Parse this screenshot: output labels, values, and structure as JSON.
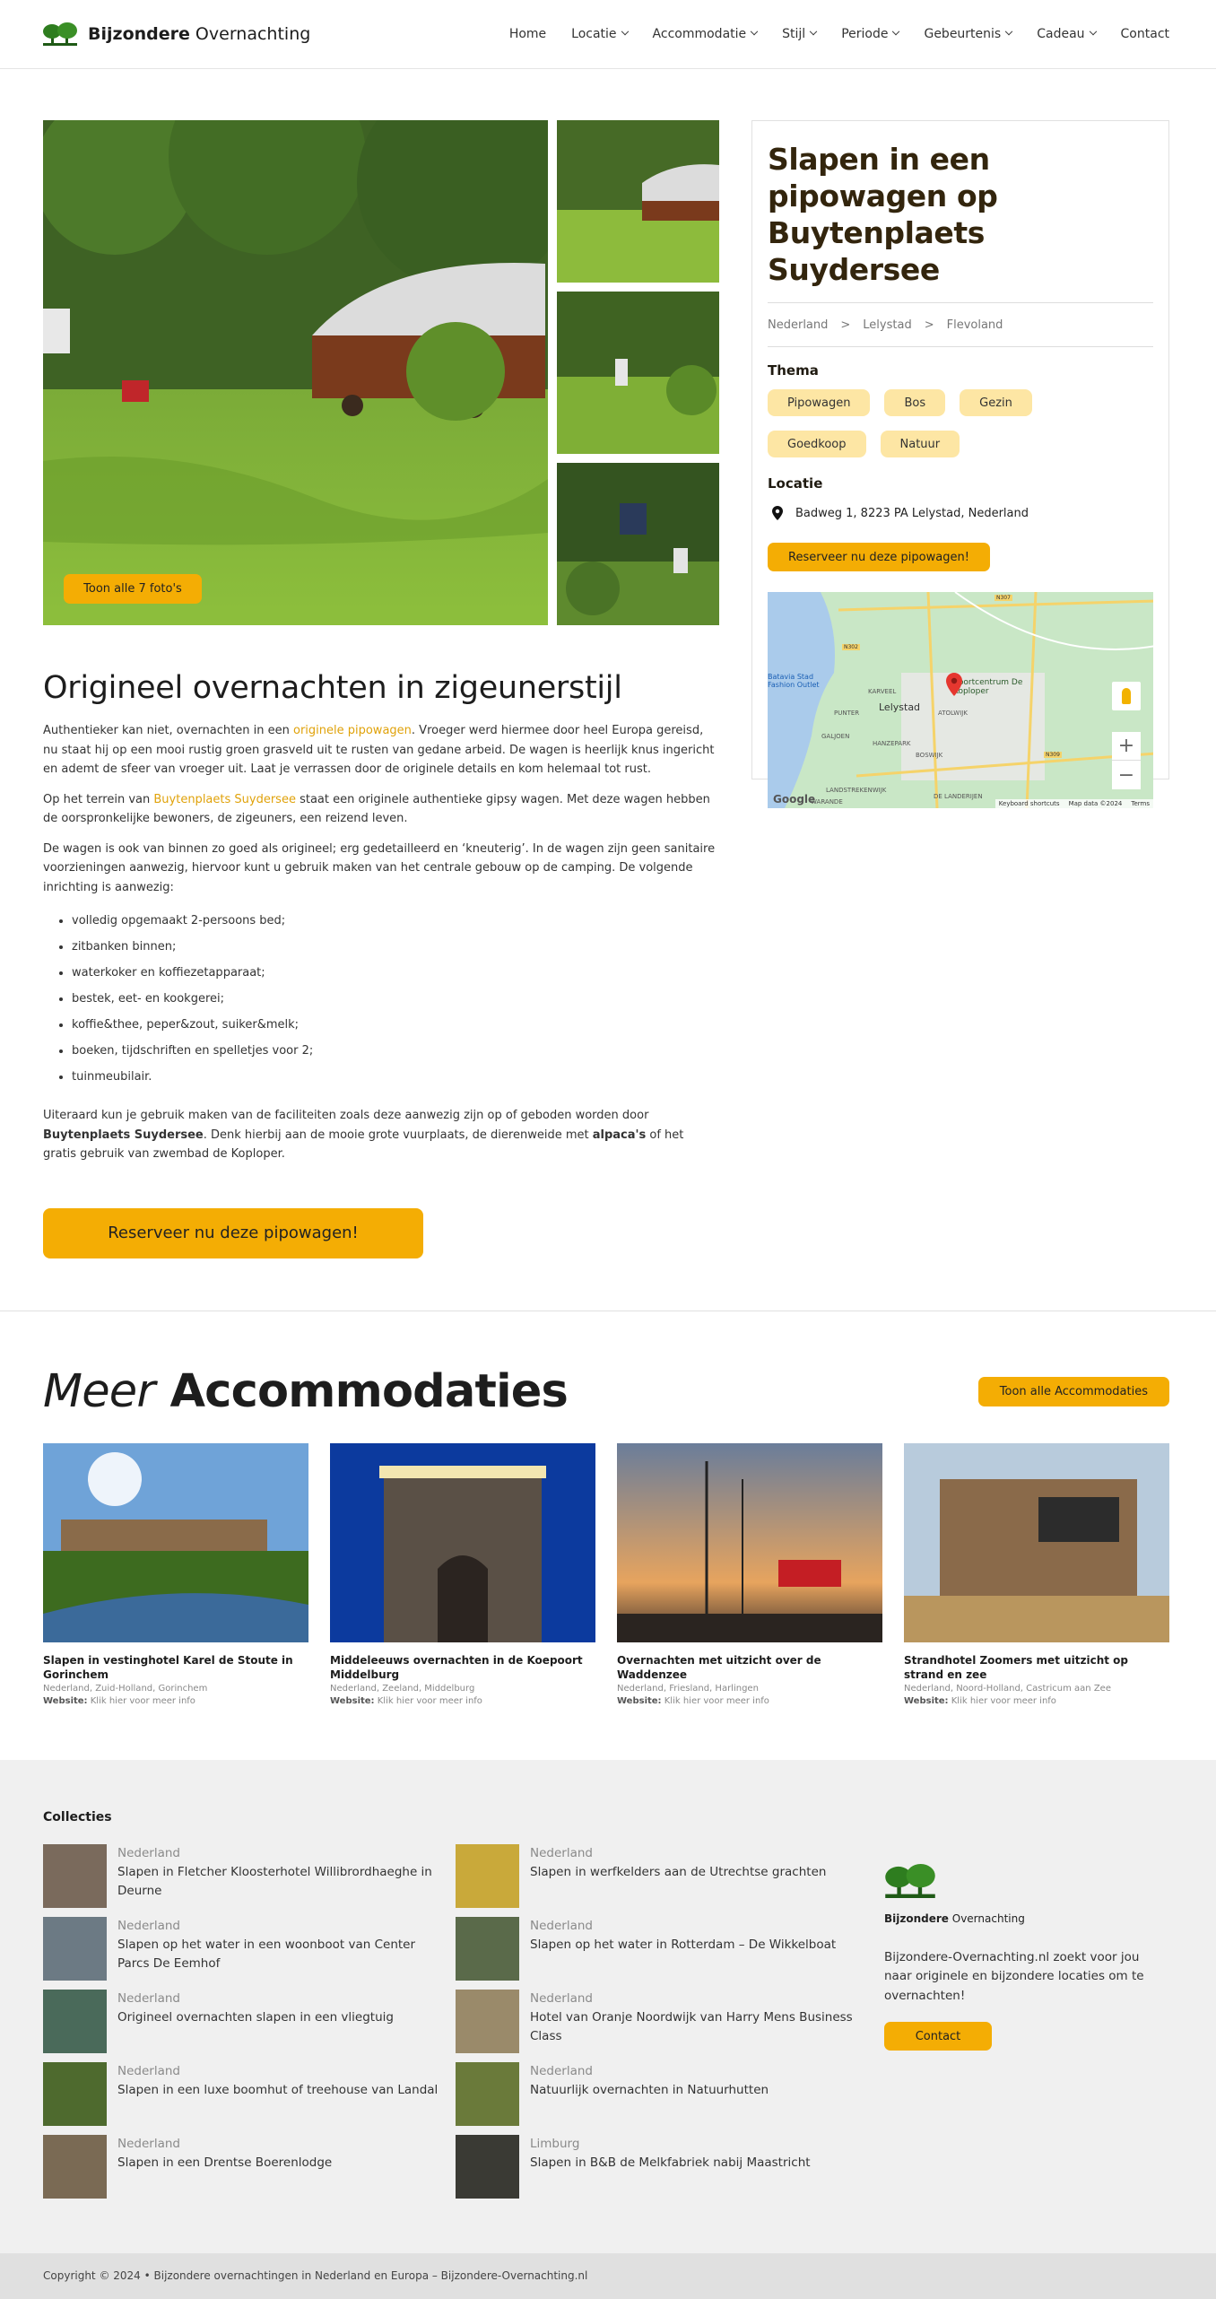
{
  "brand": {
    "bold": "Bijzondere",
    "rest": " Overnachting"
  },
  "nav": [
    {
      "label": "Home",
      "dropdown": false
    },
    {
      "label": "Locatie",
      "dropdown": true
    },
    {
      "label": "Accommodatie",
      "dropdown": true
    },
    {
      "label": "Stijl",
      "dropdown": true
    },
    {
      "label": "Periode",
      "dropdown": true
    },
    {
      "label": "Gebeurtenis",
      "dropdown": true
    },
    {
      "label": "Cadeau",
      "dropdown": true
    },
    {
      "label": "Contact",
      "dropdown": false
    }
  ],
  "gallery": {
    "show_all": "Toon alle 7 foto's"
  },
  "side": {
    "title": "Slapen in een pipowagen op Buytenplaets Suydersee",
    "breadcrumb": [
      "Nederland",
      ">",
      "Lelystad",
      ">",
      "Flevoland"
    ],
    "theme_label": "Thema",
    "tags": [
      "Pipowagen",
      "Bos",
      "Gezin",
      "Goedkoop",
      "Natuur"
    ],
    "location_label": "Locatie",
    "address": "Badweg 1, 8223 PA Lelystad, Nederland",
    "reserve": "Reserveer nu deze pipowagen!",
    "map": {
      "labels": [
        "Lelystad",
        "Sportcentrum De Koploper",
        "KARVEEL",
        "PUNTER",
        "ATOLWIJK",
        "GALJOEN",
        "HANZEPARK",
        "BOSWIJK",
        "LANDSTREKENWIJK",
        "DE LANDERIJEN",
        "WARANDE",
        "Batavia Stad Fashion Outlet",
        "N307",
        "N302",
        "N309"
      ],
      "footer": [
        "Keyboard shortcuts",
        "Map data ©2024",
        "Terms"
      ],
      "google": "Google"
    }
  },
  "article": {
    "title": "Origineel overnachten in zigeunerstijl",
    "p1_a": "Authentieker kan niet, overnachten in een ",
    "p1_link": "originele pipowagen",
    "p1_b": ". Vroeger werd hiermee door heel Europa gereisd, nu staat hij op een mooi rustig groen grasveld uit te rusten van gedane arbeid. De wagen is heerlijk knus ingericht en ademt de sfeer van vroeger uit. Laat je verrassen door de originele details en kom helemaal tot rust.",
    "p2_a": "Op het terrein van ",
    "p2_link": "Buytenplaets Suydersee",
    "p2_b": " staat een originele authentieke gipsy wagen. Met deze wagen hebben de oorspronkelijke bewoners, de zigeuners, een reizend leven.",
    "p3": "De wagen is ook van binnen zo goed als origineel; erg gedetailleerd en ‘kneuterig’. In de wagen zijn geen sanitaire voorzieningen aanwezig, hiervoor kunt u gebruik maken van het centrale gebouw op de camping. De volgende inrichting is aanwezig:",
    "list": [
      "volledig opgemaakt 2-persoons bed;",
      "zitbanken binnen;",
      "waterkoker en koffiezetapparaat;",
      "bestek, eet- en kookgerei;",
      "koffie&thee, peper&zout, suiker&melk;",
      "boeken, tijdschriften en spelletjes voor 2;",
      "tuinmeubilair."
    ],
    "p4_a": "Uiteraard kun je gebruik maken van de faciliteiten zoals deze aanwezig zijn op of geboden worden door ",
    "p4_b1": "Buytenplaets Suydersee",
    "p4_c": ". Denk hierbij aan de mooie grote vuurplaats, de dierenweide met ",
    "p4_b2": "alpaca's",
    "p4_d": " of het gratis gebruik van zwembad de Koploper.",
    "reserve": "Reserveer nu deze pipowagen!"
  },
  "more": {
    "title_italic": "Meer",
    "title_bold": " Accommodaties",
    "all_button": "Toon alle Accommodaties",
    "website_label": "Website:",
    "website_text": " Klik hier voor meer info",
    "cards": [
      {
        "title": "Slapen in vestinghotel Karel de Stoute in Gorinchem",
        "meta": "Nederland, Zuid-Holland, Gorinchem"
      },
      {
        "title": "Middeleeuws overnachten in de Koepoort Middelburg",
        "meta": "Nederland, Zeeland, Middelburg"
      },
      {
        "title": "Overnachten met uitzicht over de Waddenzee",
        "meta": "Nederland, Friesland, Harlingen"
      },
      {
        "title": "Strandhotel Zoomers met uitzicht op strand en zee",
        "meta": "Nederland, Noord-Holland, Castricum aan Zee"
      }
    ]
  },
  "footer": {
    "collections_label": "Collecties",
    "collections": [
      {
        "region": "Nederland",
        "title": "Slapen in Fletcher Kloosterhotel Willibrordhaeghe in Deurne"
      },
      {
        "region": "Nederland",
        "title": "Slapen in werfkelders aan de Utrechtse grachten"
      },
      {
        "region": "Nederland",
        "title": "Slapen op het water in een woonboot van Center Parcs De Eemhof"
      },
      {
        "region": "Nederland",
        "title": "Slapen op het water in Rotterdam – De Wikkelboat"
      },
      {
        "region": "Nederland",
        "title": "Origineel overnachten slapen in een vliegtuig"
      },
      {
        "region": "Nederland",
        "title": "Hotel van Oranje Noordwijk van Harry Mens Business Class"
      },
      {
        "region": "Nederland",
        "title": "Slapen in een luxe boomhut of treehouse van Landal"
      },
      {
        "region": "Nederland",
        "title": "Natuurlijk overnachten in Natuurhutten"
      },
      {
        "region": "Nederland",
        "title": "Slapen in een Drentse Boerenlodge"
      },
      {
        "region": "Limburg",
        "title": "Slapen in B&B de Melkfabriek nabij Maastricht"
      }
    ],
    "about_bold": "Bijzondere",
    "about_rest": " Overnachting",
    "about_text": "Bijzondere-Overnachting.nl zoekt voor jou naar originele en bijzondere locaties om te overnachten!",
    "contact": "Contact",
    "copyright": "Copyright © 2024 • Bijzondere overnachtingen in Nederland en Europa – Bijzondere-Overnachting.nl"
  },
  "colors": {
    "accent": "#f4ad04",
    "tag_bg": "#fde6a4",
    "title_brown": "#33250d",
    "link": "#e0a20a"
  }
}
